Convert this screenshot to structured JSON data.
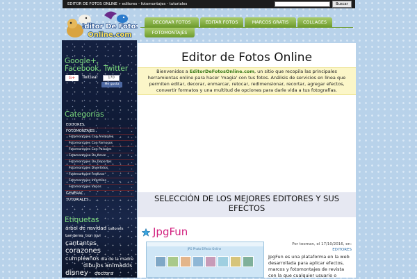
{
  "topbar": {
    "breadcrumb": "EDITOR DE FOTOS ONLINE » editores - fotomontajes - tutoriales",
    "search_placeholder": "",
    "search_button": "Buscar"
  },
  "logo": {
    "text_line1": "Editor De Fotos",
    "text_line2": "Online.com"
  },
  "nav": {
    "items": [
      "DECORAR FOTOS",
      "EDITAR FOTOS",
      "MARCOS GRATIS",
      "COLLAGES",
      "FOTOMONTAJES"
    ]
  },
  "sidebar": {
    "social_title": "Google+, Facebook, Twitter",
    "gplus": "G+",
    "twitter": "Twittear",
    "like_count": "170",
    "like_button": "Me gusta",
    "categories_title": "Categorías",
    "categories": [
      {
        "label": "EDITORES",
        "sub": false
      },
      {
        "label": "FOTOMONTAJES",
        "sub": false
      },
      {
        "label": "Fotomontajes Con Animales",
        "sub": true
      },
      {
        "label": "Fotomontajes Con Famosos",
        "sub": true
      },
      {
        "label": "Fotomontajes Con Paisajes",
        "sub": true
      },
      {
        "label": "Fotomontajes De Amor",
        "sub": true
      },
      {
        "label": "Fotomontajes De Deportes",
        "sub": true
      },
      {
        "label": "Fotomontajes Divertidos",
        "sub": true
      },
      {
        "label": "Fotomontajes Festivos",
        "sub": true
      },
      {
        "label": "Fotomontajes Infantiles",
        "sub": true
      },
      {
        "label": "Fotomontajes Varios",
        "sub": true
      },
      {
        "label": "GENERAL",
        "sub": false
      },
      {
        "label": "TUTORIALES",
        "sub": false
      }
    ],
    "tags_title": "Etiquetas",
    "tags": [
      "árbol de navidad",
      "balones",
      "banderas",
      "bon jovi",
      "cantantes",
      "corazones",
      "cumpleaños",
      "día de la madre",
      "dibujos animados",
      "disney",
      "doctora"
    ]
  },
  "main": {
    "title": "Editor de Fotos Online",
    "intro_pre": "Bienvenidos a ",
    "intro_site": "EditorDeFotosOnline.com",
    "intro_post": ", un sitio que recopila las principales herramientas online para hacer 'magia' con tus fotos. Análisis de servicios en línea que permiten editar, decorar, enmarcar, retocar, redimensionar, recortar, agregar efectos, convertir formatos y una multitud de opciones para darle vida a tus fotografías.",
    "section_title": "SELECCIÓN DE LOS MEJORES EDITORES Y SUS EFECTOS",
    "post": {
      "title": "JpgFun",
      "byline": "Por teoman, el 17/10/2016, en:",
      "category": "EDITORES",
      "thumb_caption": "JPG Photo Effects Online",
      "text": "JpgFun es una plataforma en la web desarrollada para aplicar efectos, marcos y fotomontajes de revista con la que cualquier usuario o"
    }
  },
  "colors": {
    "nav_green": "#7fa83c",
    "sidebar_bg": "#142040",
    "sidebar_title": "#7fe07f",
    "post_title": "#d2207e",
    "intro_bg": "#fbf6c8",
    "section_bg": "#e6e8f2"
  }
}
